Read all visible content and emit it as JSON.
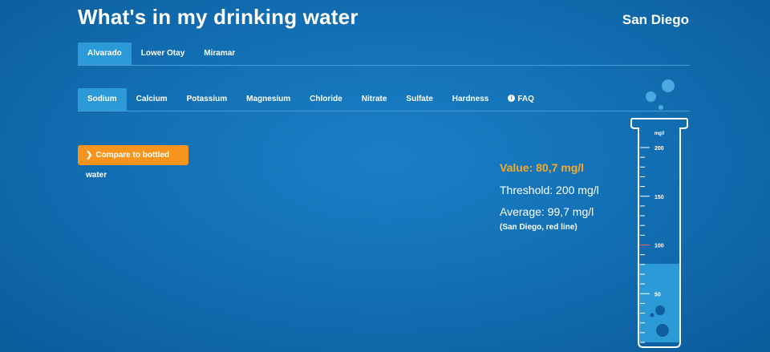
{
  "header": {
    "title": "What's in my drinking water",
    "city": "San Diego"
  },
  "plants": [
    {
      "label": "Alvarado",
      "active": true
    },
    {
      "label": "Lower Otay",
      "active": false
    },
    {
      "label": "Miramar",
      "active": false
    }
  ],
  "parameters": [
    {
      "label": "Sodium",
      "active": true
    },
    {
      "label": "Calcium",
      "active": false
    },
    {
      "label": "Potassium",
      "active": false
    },
    {
      "label": "Magnesium",
      "active": false
    },
    {
      "label": "Chloride",
      "active": false
    },
    {
      "label": "Nitrate",
      "active": false
    },
    {
      "label": "Sulfate",
      "active": false
    },
    {
      "label": "Hardness",
      "active": false
    }
  ],
  "faq": {
    "label": "FAQ",
    "icon": "info-icon"
  },
  "compare_button": {
    "label": "Compare to bottled water",
    "icon": "chevron-right-icon"
  },
  "stats": {
    "value": "Value: 80,7 mg/l",
    "threshold": "Threshold: 200 mg/l",
    "average": "Average: 99,7 mg/l",
    "average_note": "(San Diego, red line)"
  },
  "gauge": {
    "unit": "mg/l",
    "ticks": [
      "200",
      "150",
      "100",
      "50"
    ],
    "level": 80.7,
    "max": 200,
    "average": 99.7
  },
  "colors": {
    "accent": "#f7941d",
    "value": "#f7a928",
    "fill": "#2c9ad7",
    "average_line": "#e36a5a"
  }
}
